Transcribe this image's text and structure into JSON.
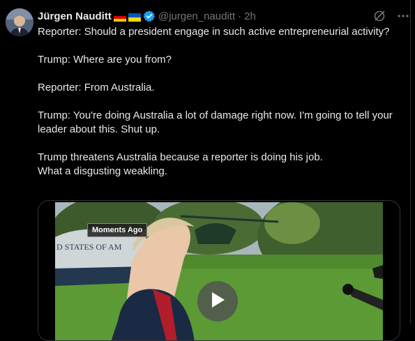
{
  "tweet": {
    "author_name": "Jürgen Nauditt",
    "handle": "@jurgen_nauditt",
    "separator": "·",
    "time": "2h",
    "paragraphs": [
      "Reporter: Should a president engage in such active entrepreneurial activity?",
      "Trump: Where are you from?",
      "Reporter: From Australia.",
      "Trump: You're doing Australia a lot of damage right now. I'm going to tell your leader about this. Shut up.",
      "Trump threatens Australia because a reporter is doing his job.\nWhat a disgusting weakling."
    ]
  },
  "media": {
    "badge": "Moments Ago",
    "plane_lettering": "D STATES OF AM"
  },
  "icons": {
    "flag_1": "germany-flag-icon",
    "flag_2": "ukraine-flag-icon",
    "verified": "verified-badge-icon",
    "grok": "grok-icon",
    "more": "more-icon",
    "play": "play-icon"
  },
  "colors": {
    "background": "#000000",
    "text": "#e7e9ea",
    "muted": "#71767b",
    "verified": "#1d9bf0"
  }
}
